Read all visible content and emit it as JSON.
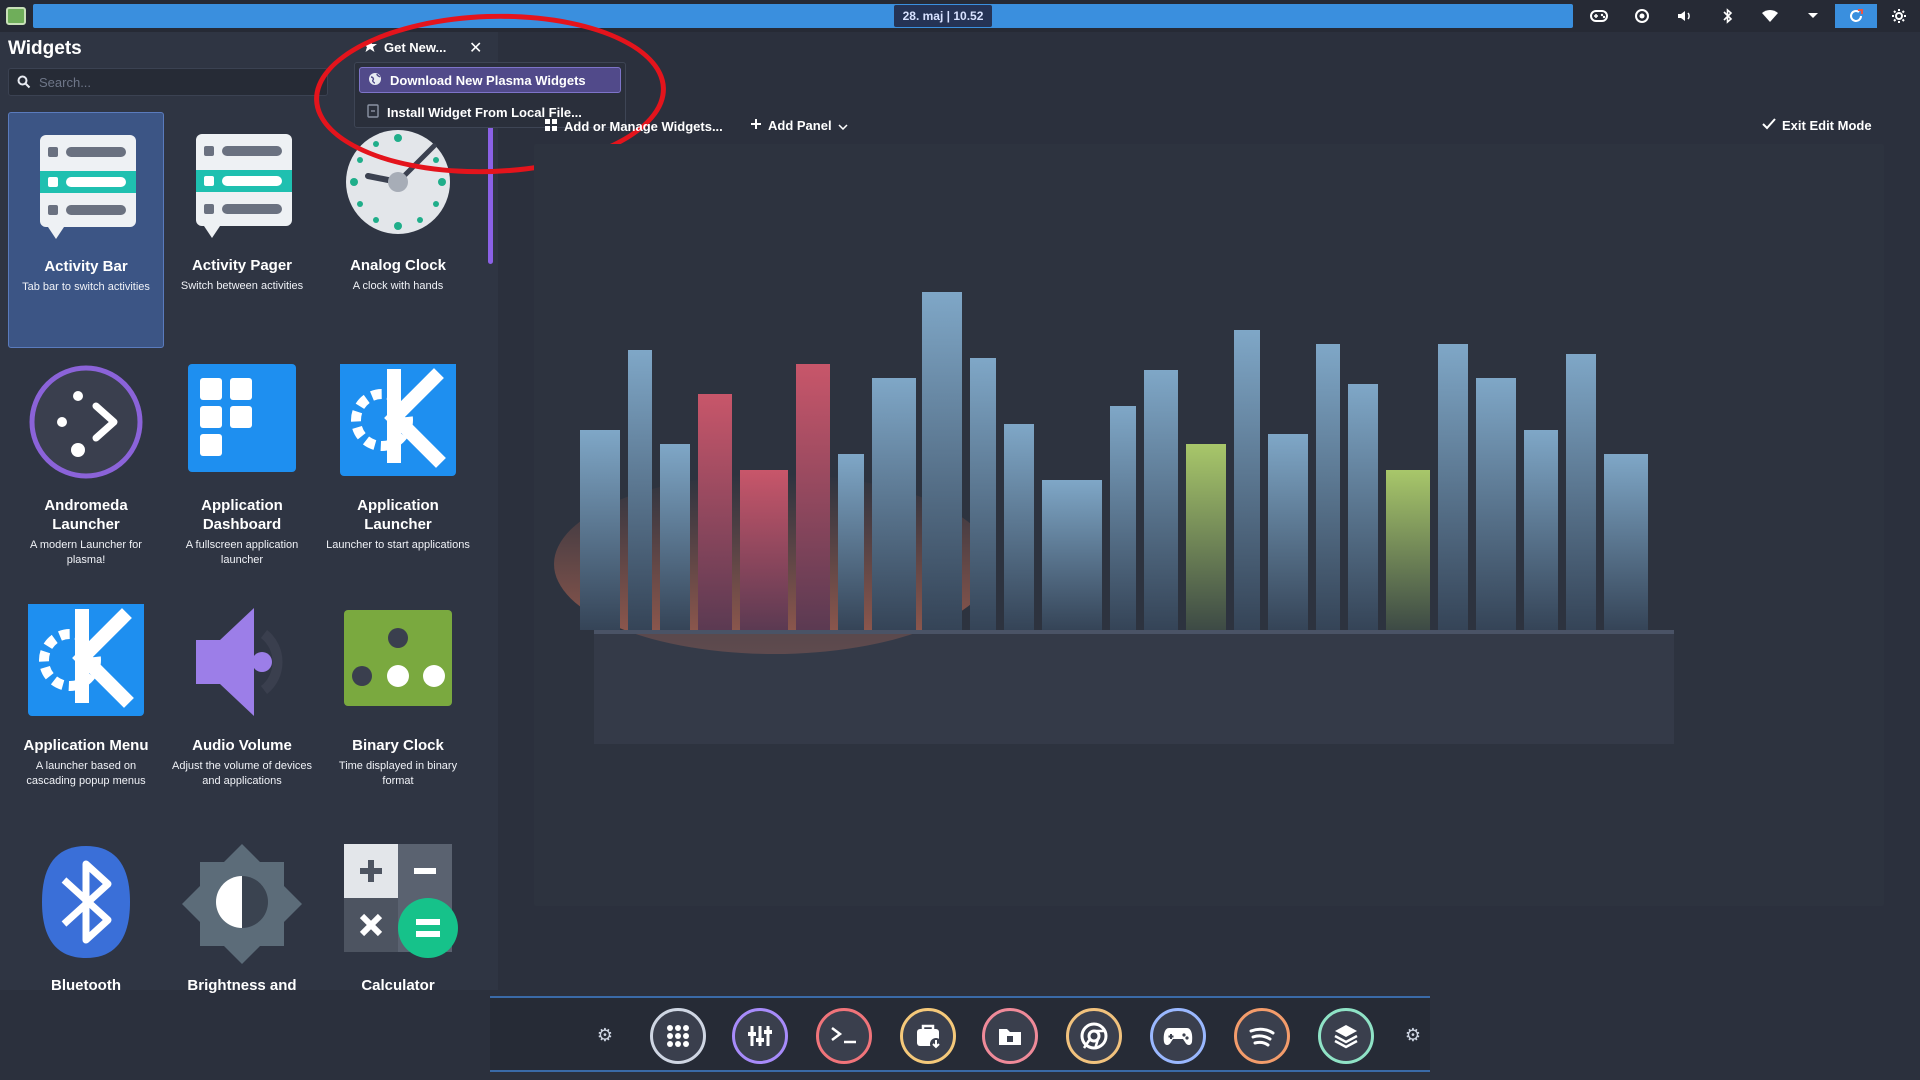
{
  "top_panel": {
    "clock": "28. maj | 10.52",
    "tray_icons": [
      "gamepad-icon",
      "settings-circle-icon",
      "volume-icon",
      "bluetooth-icon",
      "wifi-icon",
      "chevron-down-icon",
      "refresh-icon",
      "gear-icon"
    ]
  },
  "widgets": {
    "title": "Widgets",
    "search_placeholder": "Search...",
    "get_new_label": "Get New...",
    "dropdown": {
      "download": "Download New Plasma Widgets",
      "install": "Install Widget From Local File..."
    },
    "items": [
      {
        "name": "Activity Bar",
        "desc": "Tab bar to switch activities",
        "icon": "activity-bar-icon"
      },
      {
        "name": "Activity Pager",
        "desc": "Switch between activities",
        "icon": "activity-pager-icon"
      },
      {
        "name": "Analog Clock",
        "desc": "A clock with hands",
        "icon": "analog-clock-icon"
      },
      {
        "name": "Andromeda Launcher",
        "desc": "A modern Launcher for plasma!",
        "icon": "andromeda-launcher-icon"
      },
      {
        "name": "Application Dashboard",
        "desc": "A fullscreen application launcher",
        "icon": "application-dashboard-icon"
      },
      {
        "name": "Application Launcher",
        "desc": "Launcher to start applications",
        "icon": "kde-logo-icon"
      },
      {
        "name": "Application Menu",
        "desc": "A launcher based on cascading popup menus",
        "icon": "kde-logo-icon"
      },
      {
        "name": "Audio Volume",
        "desc": "Adjust the volume of devices and applications",
        "icon": "speaker-icon"
      },
      {
        "name": "Binary Clock",
        "desc": "Time displayed in binary format",
        "icon": "binary-clock-icon"
      },
      {
        "name": "Bluetooth",
        "desc": "",
        "icon": "bluetooth-icon"
      },
      {
        "name": "Brightness and",
        "desc": "",
        "icon": "brightness-icon"
      },
      {
        "name": "Calculator",
        "desc": "",
        "icon": "calculator-icon"
      }
    ]
  },
  "edit_toolbar": {
    "add_widgets": "Add or Manage Widgets...",
    "add_panel": "Add Panel",
    "exit_edit": "Exit Edit Mode"
  },
  "dock": {
    "items": [
      "app-grid-icon",
      "mixer-icon",
      "terminal-icon",
      "store-icon",
      "files-icon",
      "chrome-icon",
      "game-controller-icon",
      "spotify-icon",
      "layers-icon"
    ],
    "colors": [
      "#cfd6e3",
      "#a78bfa",
      "#f0747a",
      "#f5c97a",
      "#ef8a99",
      "#f1c27d",
      "#9ab8ff",
      "#f39c6b",
      "#8fe3c6"
    ]
  }
}
